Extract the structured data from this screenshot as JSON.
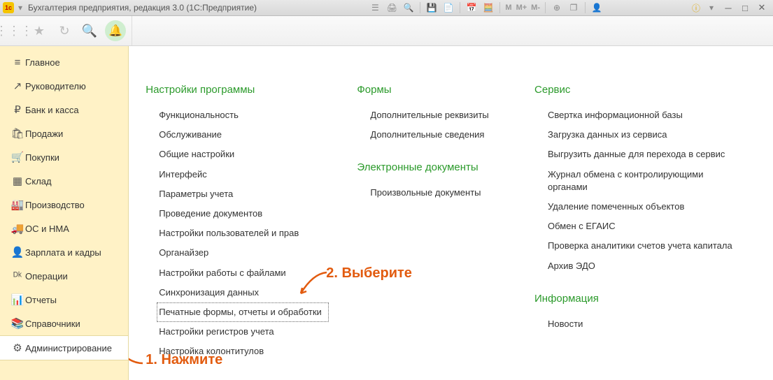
{
  "window": {
    "title": "Бухгалтерия предприятия, редакция 3.0  (1С:Предприятие)"
  },
  "titlebar_buttons_text": {
    "m": "M",
    "mplus": "M+",
    "mminus": "M-"
  },
  "sidebar": {
    "items": [
      {
        "icon": "≡",
        "label": "Главное",
        "name": "main"
      },
      {
        "icon": "↗",
        "label": "Руководителю",
        "name": "manager"
      },
      {
        "icon": "₽",
        "label": "Банк и касса",
        "name": "bank"
      },
      {
        "icon": "🛍",
        "label": "Продажи",
        "name": "sales"
      },
      {
        "icon": "🛒",
        "label": "Покупки",
        "name": "purchases"
      },
      {
        "icon": "▦",
        "label": "Склад",
        "name": "inventory"
      },
      {
        "icon": "🏭",
        "label": "Производство",
        "name": "production"
      },
      {
        "icon": "🚚",
        "label": "ОС и НМА",
        "name": "assets"
      },
      {
        "icon": "👤",
        "label": "Зарплата и кадры",
        "name": "hr"
      },
      {
        "icon": "ᴰᵏ",
        "label": "Операции",
        "name": "operations"
      },
      {
        "icon": "📊",
        "label": "Отчеты",
        "name": "reports"
      },
      {
        "icon": "📚",
        "label": "Справочники",
        "name": "catalogs"
      },
      {
        "icon": "⚙",
        "label": "Администрирование",
        "name": "administration"
      }
    ],
    "active_index": 12
  },
  "content": {
    "col1": {
      "title": "Настройки программы",
      "items": [
        "Функциональность",
        "Обслуживание",
        "Общие настройки",
        "Интерфейс",
        "Параметры учета",
        "Проведение документов",
        "Настройки пользователей и прав",
        "Органайзер",
        "Настройки работы с файлами",
        "Синхронизация данных",
        "Печатные формы, отчеты и обработки",
        "Настройки регистров учета",
        "Настройка колонтитулов"
      ],
      "highlight_index": 10
    },
    "col2": {
      "section_a": {
        "title": "Формы",
        "items": [
          "Дополнительные реквизиты",
          "Дополнительные сведения"
        ]
      },
      "section_b": {
        "title": "Электронные документы",
        "items": [
          "Произвольные документы"
        ]
      }
    },
    "col3": {
      "section_a": {
        "title": "Сервис",
        "items": [
          "Свертка информационной базы",
          "Загрузка данных из сервиса",
          "Выгрузить данные для перехода в сервис",
          "Журнал обмена с контролирующими органами",
          "Удаление помеченных объектов",
          "Обмен с ЕГАИС",
          "Проверка аналитики счетов учета капитала",
          "Архив ЭДО"
        ]
      },
      "section_b": {
        "title": "Информация",
        "items": [
          "Новости"
        ]
      }
    }
  },
  "annotations": {
    "step1": "1. Нажмите",
    "step2": "2. Выберите"
  }
}
